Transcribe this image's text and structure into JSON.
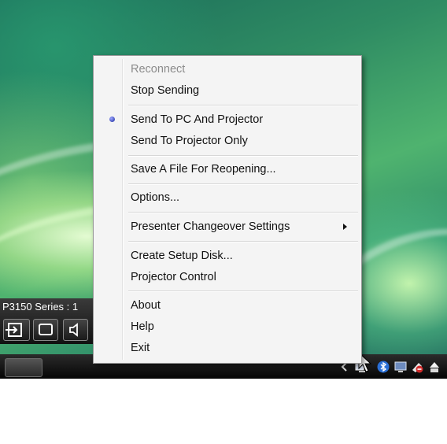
{
  "projector_bar": {
    "label": "P3150 Series : 1"
  },
  "menu": {
    "items": [
      {
        "label": "Reconnect",
        "enabled": false
      },
      {
        "label": "Stop Sending",
        "enabled": true
      },
      {
        "label": "Send To PC And Projector",
        "enabled": true,
        "selected": true
      },
      {
        "label": "Send To Projector Only",
        "enabled": true
      },
      {
        "label": "Save A File For Reopening...",
        "enabled": true
      },
      {
        "label": "Options...",
        "enabled": true
      },
      {
        "label": "Presenter Changeover Settings",
        "enabled": true,
        "submenu": true
      },
      {
        "label": "Create Setup Disk...",
        "enabled": true
      },
      {
        "label": "Projector Control",
        "enabled": true
      },
      {
        "label": "About",
        "enabled": true
      },
      {
        "label": "Help",
        "enabled": true
      },
      {
        "label": "Exit",
        "enabled": true
      }
    ]
  },
  "tray": {
    "icons": [
      "chevron-left-icon",
      "network-icon",
      "bluetooth-icon",
      "monitor-icon",
      "security-icon",
      "eject-icon"
    ]
  },
  "colors": {
    "menu_background": "#f4f4f4",
    "disabled_text": "#8c8c8c",
    "bullet": "#1a2a9a"
  }
}
